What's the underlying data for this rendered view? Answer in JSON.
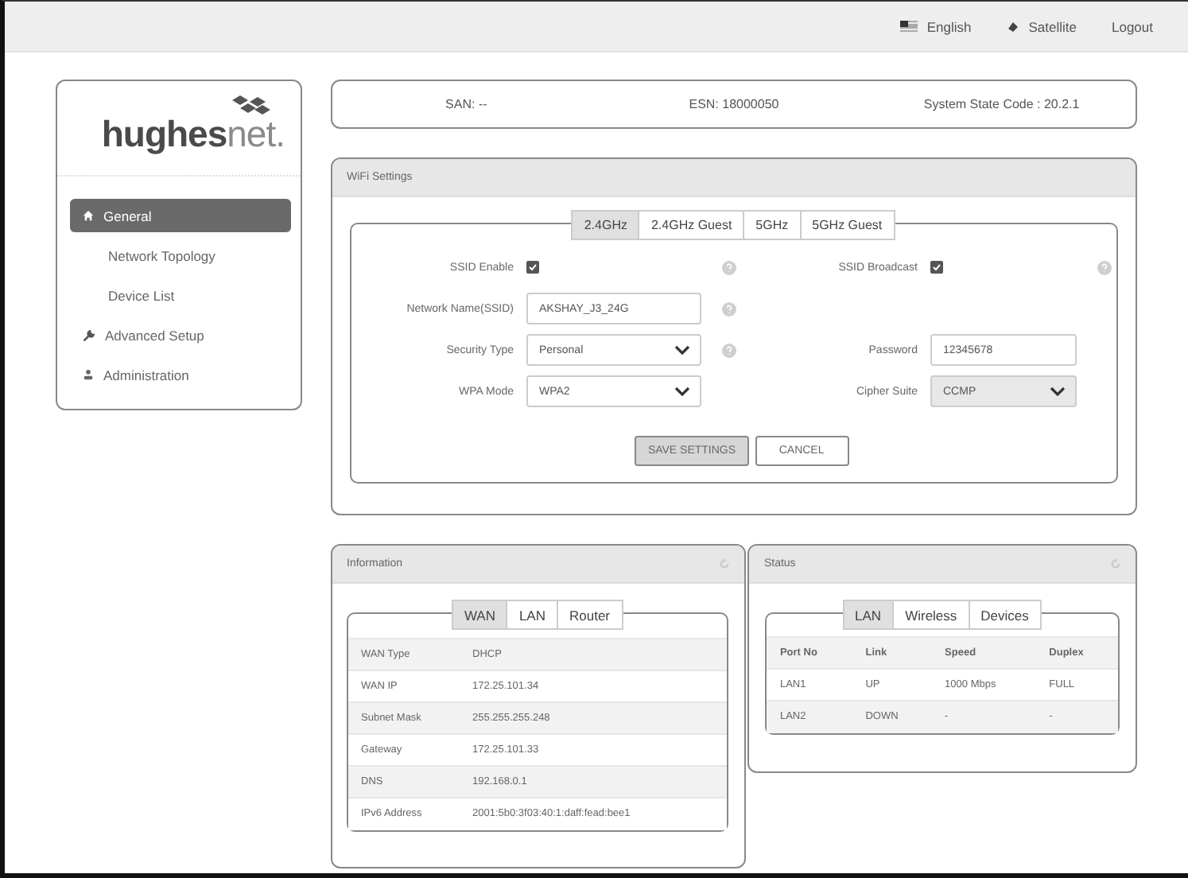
{
  "top_bar": {
    "language": "English",
    "connection": "Satellite",
    "logout": "Logout"
  },
  "logo": {
    "primary": "hughes",
    "secondary": "net."
  },
  "nav": [
    {
      "label": "General",
      "selected": true,
      "children": [
        {
          "label": "Network Topology",
          "selected": false
        },
        {
          "label": "Device List",
          "selected": false
        }
      ]
    },
    {
      "label": "Advanced Setup",
      "selected": false
    },
    {
      "label": "Administration",
      "selected": false
    }
  ],
  "header": {
    "san": "SAN: --",
    "esn": "ESN: 18000050",
    "state_code": "System State Code : 20.2.1"
  },
  "wifi": {
    "title": "WiFi Settings",
    "tabs": [
      {
        "label": "2.4GHz",
        "selected": true
      },
      {
        "label": "2.4GHz Guest",
        "selected": false
      },
      {
        "label": "5GHz",
        "selected": false
      },
      {
        "label": "5GHz Guest",
        "selected": false
      }
    ],
    "rows": [
      [
        {
          "label": "SSID Enable",
          "kind": "checkbox",
          "checked": true,
          "help": true
        },
        {
          "label": "SSID Broadcast",
          "kind": "checkbox",
          "checked": true,
          "help": true
        }
      ],
      [
        {
          "label": "Network Name(SSID)",
          "kind": "text",
          "value": "AKSHAY_J3_24G",
          "disabled": false,
          "help": true
        }
      ],
      [
        {
          "label": "Security Type",
          "kind": "select",
          "value": "Personal",
          "disabled": false,
          "help": true
        },
        {
          "label": "Password",
          "kind": "text",
          "value": "12345678",
          "disabled": false,
          "help": false
        }
      ],
      [
        {
          "label": "WPA Mode",
          "kind": "select",
          "value": "WPA2",
          "disabled": false,
          "help": false
        },
        {
          "label": "Cipher Suite",
          "kind": "select",
          "value": "CCMP",
          "disabled": true,
          "help": false
        }
      ]
    ],
    "buttons": [
      {
        "label": "SAVE SETTINGS",
        "primary": true
      },
      {
        "label": "CANCEL",
        "primary": false
      }
    ]
  },
  "information": {
    "title": "Information",
    "tabs": [
      {
        "label": "WAN",
        "selected": true
      },
      {
        "label": "LAN",
        "selected": false
      },
      {
        "label": "Router",
        "selected": false
      }
    ],
    "rows": [
      [
        "WAN Type",
        "DHCP"
      ],
      [
        "WAN IP",
        "172.25.101.34"
      ],
      [
        "Subnet Mask",
        "255.255.255.248"
      ],
      [
        "Gateway",
        "172.25.101.33"
      ],
      [
        "DNS",
        "192.168.0.1"
      ],
      [
        "IPv6 Address",
        "2001:5b0:3f03:40:1:daff:fead:bee1"
      ]
    ]
  },
  "status": {
    "title": "Status",
    "tabs": [
      {
        "label": "LAN",
        "selected": true
      },
      {
        "label": "Wireless",
        "selected": false
      },
      {
        "label": "Devices",
        "selected": false
      }
    ],
    "columns": [
      "Port No",
      "Link",
      "Speed",
      "Duplex"
    ],
    "rows": [
      [
        "LAN1",
        "UP",
        "1000 Mbps",
        "FULL"
      ],
      [
        "LAN2",
        "DOWN",
        "-",
        "-"
      ]
    ]
  }
}
